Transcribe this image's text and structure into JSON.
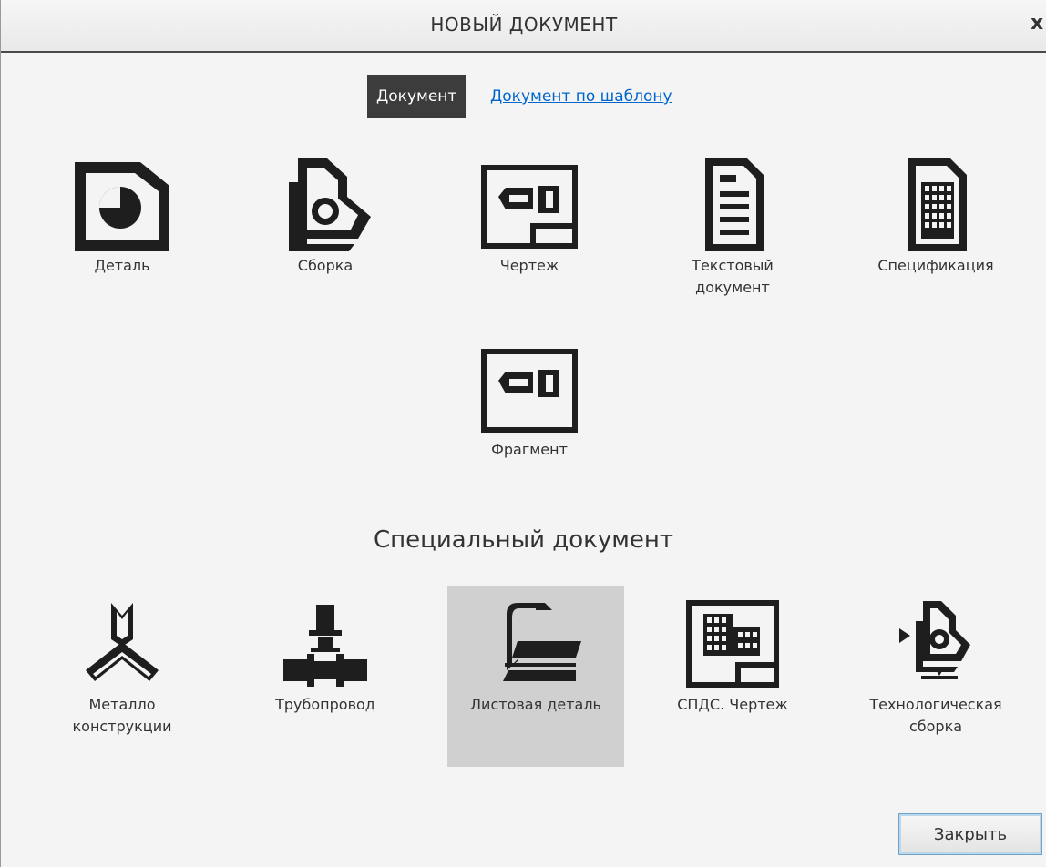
{
  "window": {
    "title": "НОВЫЙ ДОКУМЕНТ",
    "close_glyph": "x"
  },
  "tabs": {
    "active": "Документ",
    "template_link": "Документ по шаблону"
  },
  "documents": [
    {
      "label": "Деталь",
      "icon": "part-icon"
    },
    {
      "label": "Сборка",
      "icon": "assembly-icon"
    },
    {
      "label": "Чертеж",
      "icon": "drawing-icon"
    },
    {
      "label": "Текстовый\nдокумент",
      "icon": "text-document-icon"
    },
    {
      "label": "Спецификация",
      "icon": "specification-icon"
    },
    {
      "label": "Фрагмент",
      "icon": "fragment-icon"
    }
  ],
  "special": {
    "title": "Специальный документ",
    "items": [
      {
        "label": "Металло\nконструкции",
        "icon": "metal-structures-icon"
      },
      {
        "label": "Трубопровод",
        "icon": "pipeline-icon"
      },
      {
        "label": "Листовая деталь",
        "icon": "sheet-part-icon",
        "selected": true
      },
      {
        "label": "СПДС. Чертеж",
        "icon": "spds-drawing-icon"
      },
      {
        "label": "Технологическая\nсборка",
        "icon": "tech-assembly-icon"
      }
    ]
  },
  "footer": {
    "close_label": "Закрыть"
  },
  "colors": {
    "icon": "#1e1e1e",
    "active_tab": "#3c3c3c",
    "link": "#0066cc",
    "selected_tile": "#d0d0d0"
  }
}
